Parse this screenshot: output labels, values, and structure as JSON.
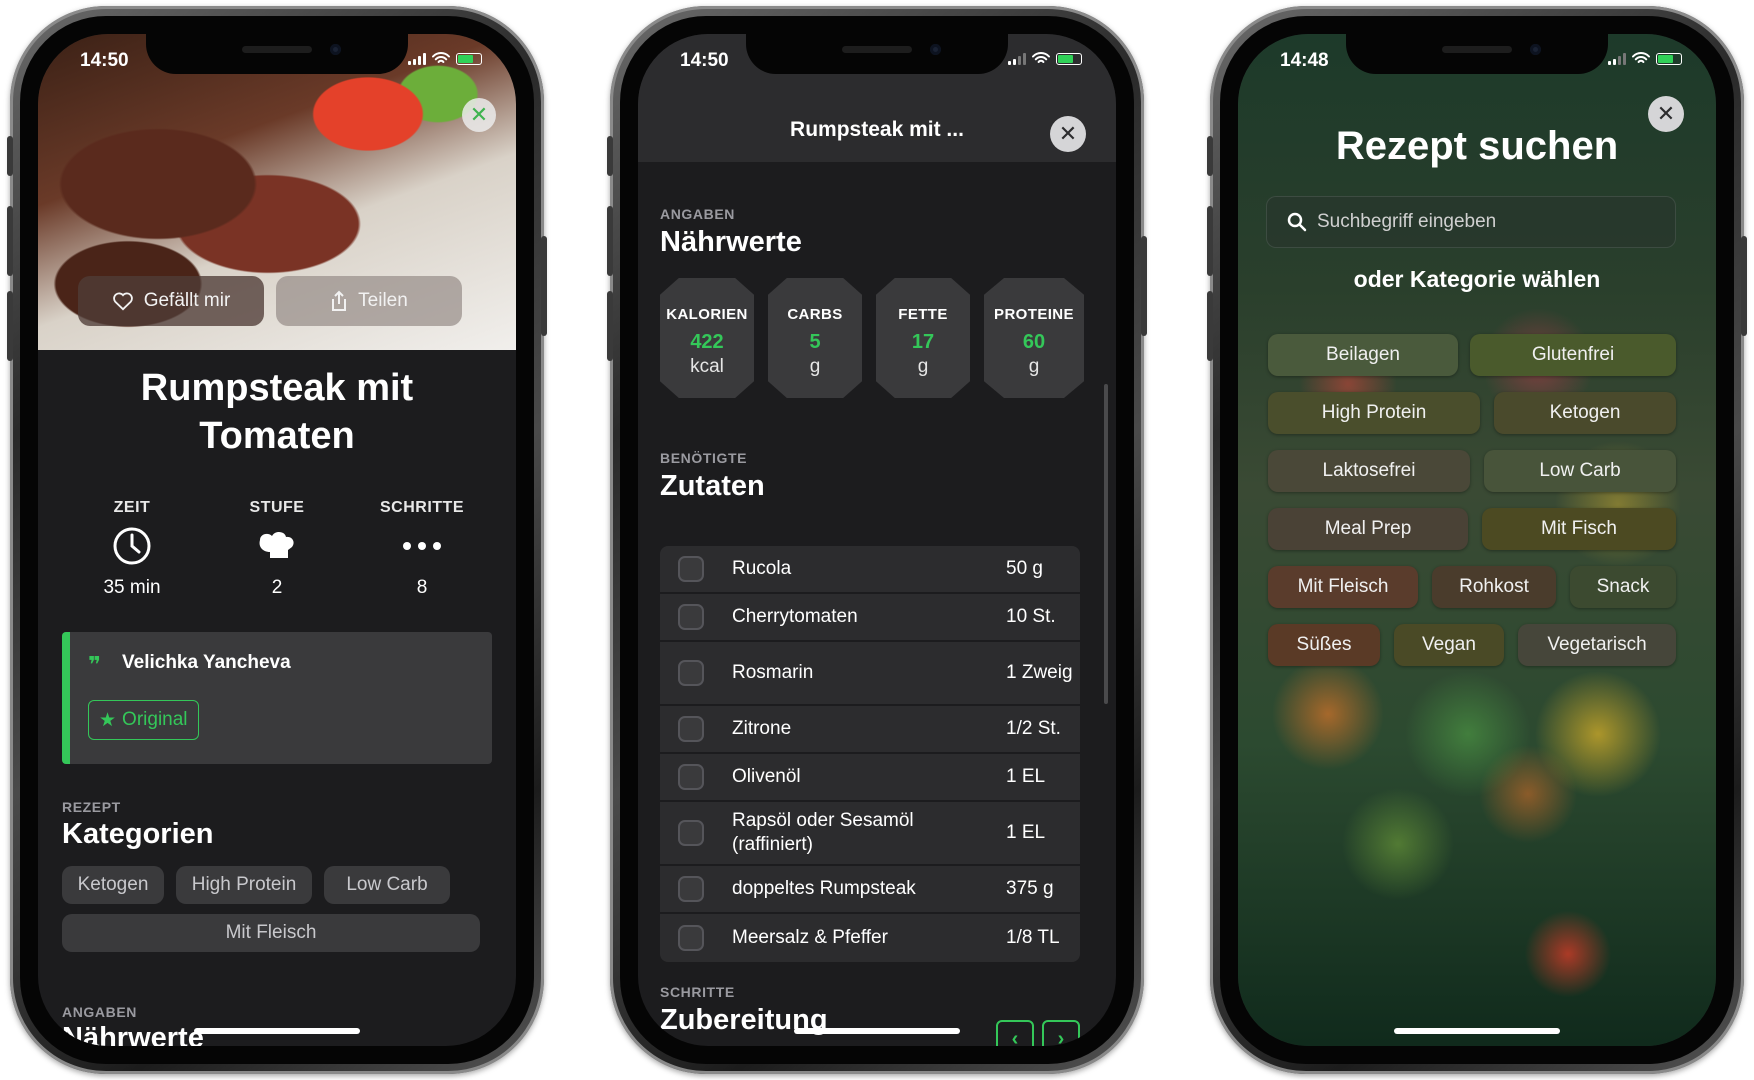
{
  "phone1": {
    "status_time": "14:50",
    "hero": {
      "like_label": "Gefällt mir",
      "share_label": "Teilen",
      "close_glyph": "✕"
    },
    "title": "Rumpsteak mit Tomaten",
    "stats": [
      {
        "label": "ZEIT",
        "value": "35 min",
        "icon": "clock-icon"
      },
      {
        "label": "STUFE",
        "value": "2",
        "icon": "chef-hat-icon"
      },
      {
        "label": "SCHRITTE",
        "value": "8",
        "icon": "more-dots-icon"
      }
    ],
    "author": {
      "name": "Velichka Yancheva",
      "badge": "Original"
    },
    "categories": {
      "kicker": "REZEPT",
      "title": "Kategorien",
      "chips": [
        "Ketogen",
        "High Protein",
        "Low Carb",
        "Mit Fleisch"
      ]
    },
    "next_section": {
      "kicker": "ANGABEN",
      "title": "Nährwerte"
    }
  },
  "phone2": {
    "status_time": "14:50",
    "header_title": "Rumpsteak mit ...",
    "close_glyph": "✕",
    "nutrition": {
      "kicker": "ANGABEN",
      "title": "Nährwerte",
      "items": [
        {
          "label": "KALORIEN",
          "value": "422",
          "unit": "kcal"
        },
        {
          "label": "CARBS",
          "value": "5",
          "unit": "g"
        },
        {
          "label": "FETTE",
          "value": "17",
          "unit": "g"
        },
        {
          "label": "PROTEINE",
          "value": "60",
          "unit": "g"
        }
      ]
    },
    "ingredients": {
      "kicker": "BENÖTIGTE",
      "title": "Zutaten",
      "rows": [
        {
          "name": "Rucola",
          "qty": "50 g"
        },
        {
          "name": "Cherrytomaten",
          "qty": "10 St."
        },
        {
          "name": "Rosmarin",
          "qty": "1 Zweig"
        },
        {
          "name": "Zitrone",
          "qty": "1/2 St."
        },
        {
          "name": "Olivenöl",
          "qty": "1 EL"
        },
        {
          "name": "Rapsöl oder Sesamöl (raffiniert)",
          "qty": "1 EL"
        },
        {
          "name": "doppeltes Rumpsteak",
          "qty": "375 g"
        },
        {
          "name": "Meersalz & Pfeffer",
          "qty": "1/8 TL"
        }
      ]
    },
    "steps": {
      "kicker": "SCHRITTE",
      "title": "Zubereitung",
      "prev_glyph": "‹",
      "next_glyph": "›"
    }
  },
  "phone3": {
    "status_time": "14:48",
    "close_glyph": "✕",
    "title": "Rezept suchen",
    "search_placeholder": "Suchbegriff eingeben",
    "subtitle": "oder Kategorie wählen",
    "tags": [
      "Beilagen",
      "Glutenfrei",
      "High Protein",
      "Ketogen",
      "Laktosefrei",
      "Low Carb",
      "Meal Prep",
      "Mit Fisch",
      "Mit Fleisch",
      "Rohkost",
      "Snack",
      "Süßes",
      "Vegan",
      "Vegetarisch"
    ]
  },
  "colors": {
    "accent": "#34c759",
    "card": "#3a3a3c",
    "background": "#1c1c1e"
  }
}
